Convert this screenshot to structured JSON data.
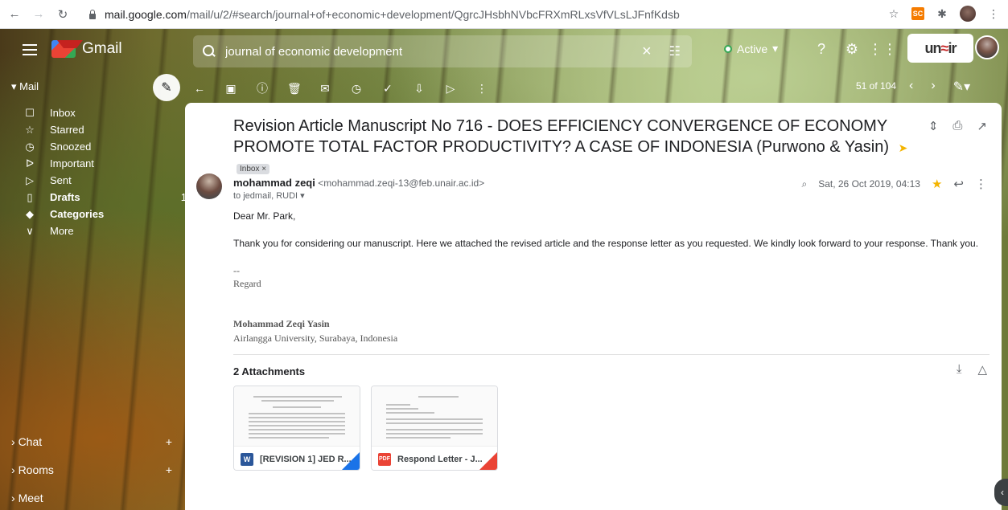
{
  "browser": {
    "url_host": "mail.google.com",
    "url_path": "/mail/u/2/#search/journal+of+economic+development/QgrcJHsbhNVbcFRXmRLxsVfVLsLJFnfKdsb",
    "ext_sc": "SC"
  },
  "header": {
    "app_name": "Gmail",
    "search_value": "journal of economic development",
    "status": "Active",
    "brand_left": "un",
    "brand_right": "ir"
  },
  "sidebar": {
    "section": "Mail",
    "items": [
      {
        "icon": "☐",
        "label": "Inbox",
        "count": ""
      },
      {
        "icon": "☆",
        "label": "Starred",
        "count": ""
      },
      {
        "icon": "◷",
        "label": "Snoozed",
        "count": ""
      },
      {
        "icon": "ᐅ",
        "label": "Important",
        "count": ""
      },
      {
        "icon": "▷",
        "label": "Sent",
        "count": ""
      },
      {
        "icon": "▯",
        "label": "Drafts",
        "count": "1"
      },
      {
        "icon": "◆",
        "label": "Categories",
        "count": ""
      },
      {
        "icon": "∨",
        "label": "More",
        "count": ""
      }
    ],
    "chat": "Chat",
    "rooms": "Rooms",
    "meet": "Meet"
  },
  "toolbar": {
    "pager": "51 of 104"
  },
  "message": {
    "subject": "Revision Article Manuscript No 716 - DOES EFFICIENCY CONVERGENCE OF ECONOMY PROMOTE TOTAL FACTOR PRODUCTIVITY? A CASE OF INDONESIA (Purwono & Yasin)",
    "label": "Inbox ×",
    "sender_name": "mohammad zeqi",
    "sender_email": "<mohammad.zeqi-13@feb.unair.ac.id>",
    "to": "to jedmail, RUDI ▾",
    "date": "Sat, 26 Oct 2019, 04:13",
    "greeting": "Dear Mr. Park,",
    "body": "Thank you for considering our manuscript. Here we attached the revised article and the response letter as you requested. We kindly look forward to your response. Thank you.",
    "sig_dash": "--",
    "sig_regard": "Regard",
    "sig_name": "Mohammad Zeqi Yasin",
    "sig_affil": "Airlangga University, Surabaya, Indonesia"
  },
  "attachments": {
    "title": "2 Attachments",
    "items": [
      {
        "type": "W",
        "name": "[REVISION 1] JED R...",
        "color": "#2b579a",
        "corner": "#1a73e8"
      },
      {
        "type": "PDF",
        "name": "Respond Letter - J...",
        "color": "#ea4335",
        "corner": "#ea4335"
      }
    ]
  }
}
